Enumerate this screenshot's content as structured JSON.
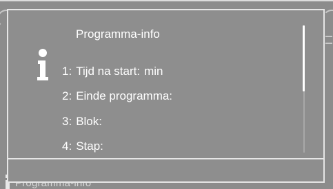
{
  "background": {
    "title": "Programma-info",
    "info_icon": "info-icon"
  },
  "popup": {
    "title": "Programma-info",
    "icon": "info-icon",
    "items": [
      {
        "number": "1:",
        "label": "Tijd na start:",
        "value": "min"
      },
      {
        "number": "2:",
        "label": "Einde programma:",
        "value": ""
      },
      {
        "number": "3:",
        "label": "Blok:",
        "value": ""
      },
      {
        "number": "4:",
        "label": "Stap:",
        "value": ""
      }
    ],
    "scroll": {
      "position_fraction": 0.0,
      "visible_fraction": 0.52
    }
  },
  "colors": {
    "screen_background": "#8c8c8c",
    "popup_border": "#e6e6e6",
    "text": "#ffffff"
  }
}
